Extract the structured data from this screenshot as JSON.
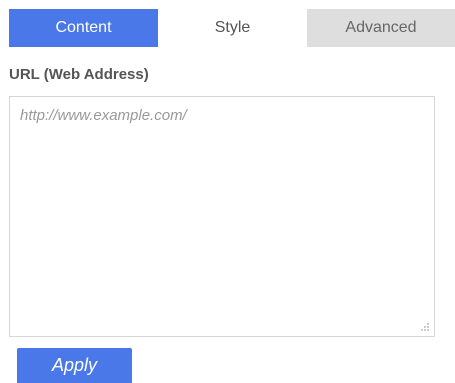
{
  "tabs": {
    "content": "Content",
    "style": "Style",
    "advanced": "Advanced"
  },
  "url_field": {
    "label": "URL (Web Address)",
    "value": "",
    "placeholder": "http://www.example.com/"
  },
  "apply_label": "Apply",
  "colors": {
    "accent": "#4a78e8",
    "inactive_tab": "#dedede",
    "text": "#555555",
    "placeholder": "#999999"
  }
}
